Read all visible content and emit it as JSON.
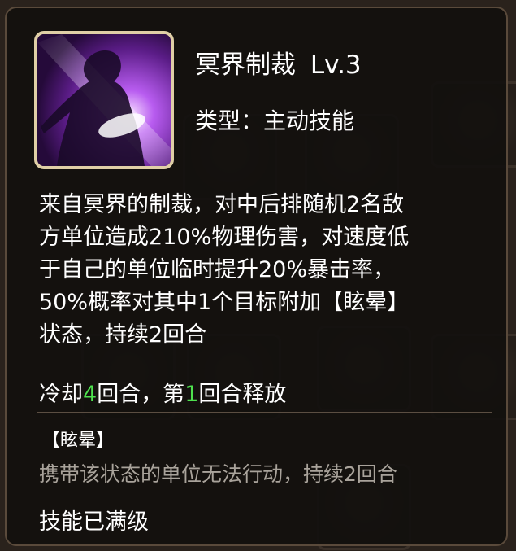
{
  "skill": {
    "name": "冥界制裁",
    "level": "Lv.3",
    "type_label": "类型：",
    "type_value": "主动技能",
    "icon": "purple-silhouette-skill-icon"
  },
  "description_lines": [
    "来自冥界的制裁，对中后排随机2名敌",
    "方单位造成210%物理伤害，对速度低",
    "于自己的单位临时提升20%暴击率，",
    "50%概率对其中1个目标附加【眩晕】",
    "状态，持续2回合"
  ],
  "cooldown": {
    "prefix": "冷却",
    "cooldown_turns": "4",
    "middle": "回合，第",
    "release_turn": "1",
    "suffix": "回合释放"
  },
  "status": {
    "title": "【眩晕】",
    "description": "携带该状态的单位无法行动，持续2回合"
  },
  "footer": {
    "maxed_text": "技能已满级"
  },
  "colors": {
    "highlight_number": "#4ee24e",
    "icon_border": "#e0cfa6",
    "muted_text": "#a9a39b"
  }
}
